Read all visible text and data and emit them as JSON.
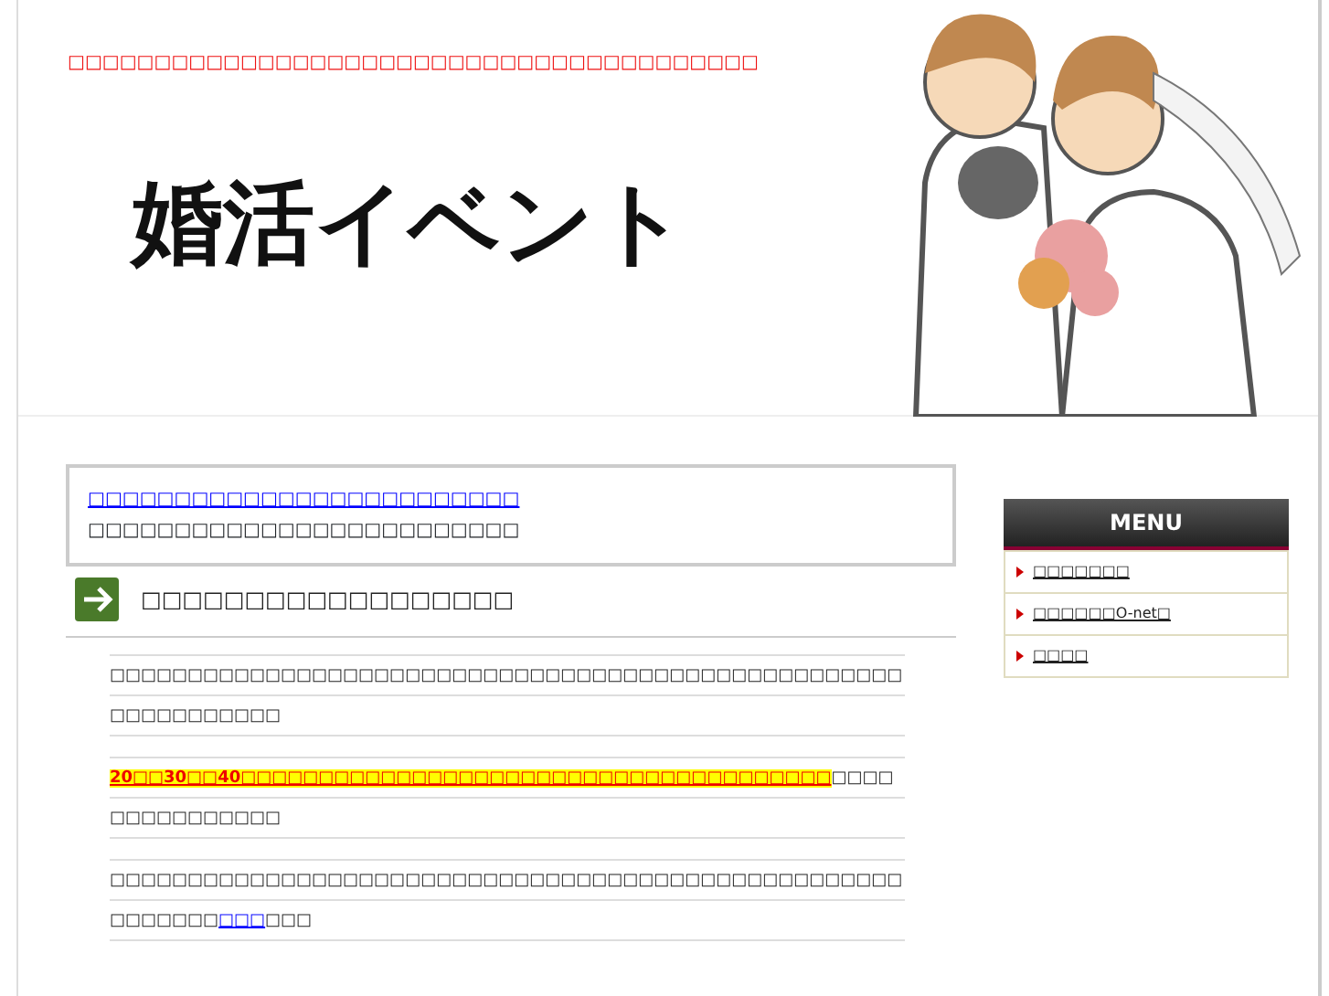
{
  "header": {
    "tagline": "□□□□□□□□□□□□□□□□□□□□□□□□□□□□□□□□□□□□□□□□",
    "logo": "婚活イベント"
  },
  "notice": {
    "link": "□□□□□□□□□□□□□□□□□□□□□□□□□",
    "text": "□□□□□□□□□□□□□□□□□□□□□□□□□"
  },
  "article": {
    "heading": "□□□□□□□□□□□□□□□□□□",
    "paragraphs": [
      [
        {
          "kind": "text",
          "text": "□□□□□□□□□□□□□□□□□□□□□□□□□□□□□□□□□□□□□□□□□□□□□□□□□□□□□□□□□□□□□□"
        }
      ],
      [
        {
          "kind": "highlight",
          "text": "20□□30□□40□□□□□□□□□□□□□□□□□□□□□□□□□□□□□□□□□□□□□□"
        },
        {
          "kind": "text",
          "text": "□□□□□□□□□□□□□□□"
        }
      ],
      [
        {
          "kind": "text",
          "text": "□□□□□□□□□□□□□□□□□□□□□□□□□□□□□□□□□□□□□□□□□□□□□□□□□□□□□□□□□□"
        },
        {
          "kind": "link",
          "text": "□□□"
        },
        {
          "kind": "text",
          "text": "□□□"
        }
      ]
    ]
  },
  "sidebar": {
    "title": "MENU",
    "items": [
      "□□□□□□□",
      "□□□□□□O-net□",
      "□□□□"
    ]
  }
}
